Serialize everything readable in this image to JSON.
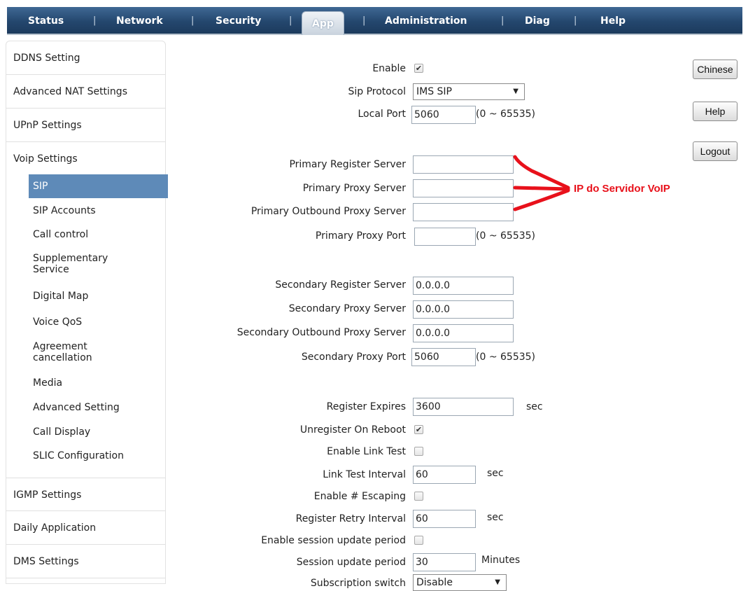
{
  "nav": {
    "tabs": [
      "Status",
      "Network",
      "Security",
      "App",
      "Administration",
      "Diag",
      "Help"
    ],
    "active": "App"
  },
  "sidebar": {
    "sections": {
      "ddns": "DDNS Setting",
      "nat": "Advanced NAT Settings",
      "upnp": "UPnP Settings",
      "voip": "Voip Settings",
      "igmp": "IGMP Settings",
      "daily": "Daily Application",
      "dms": "DMS Settings"
    },
    "voip_items": {
      "sip": "SIP",
      "sip_accounts": "SIP Accounts",
      "call_control": "Call control",
      "supplementary": "Supplementary\nService",
      "digital_map": "Digital Map",
      "voice_qos": "Voice QoS",
      "agreement": "Agreement\ncancellation",
      "media": "Media",
      "advanced": "Advanced Setting",
      "call_display": "Call Display",
      "slic": "SLIC Configuration"
    }
  },
  "form": {
    "enable": {
      "label": "Enable",
      "checked": true
    },
    "sip_protocol": {
      "label": "Sip Protocol",
      "value": "IMS SIP"
    },
    "local_port": {
      "label": "Local Port",
      "value": "5060",
      "hint": "(0 ~ 65535)"
    },
    "primary_register": {
      "label": "Primary Register Server",
      "value": ""
    },
    "primary_proxy": {
      "label": "Primary Proxy Server",
      "value": ""
    },
    "primary_outbound": {
      "label": "Primary Outbound Proxy Server",
      "value": ""
    },
    "primary_port": {
      "label": "Primary Proxy Port",
      "value": "",
      "hint": "(0 ~ 65535)"
    },
    "secondary_register": {
      "label": "Secondary Register Server",
      "value": "0.0.0.0"
    },
    "secondary_proxy": {
      "label": "Secondary Proxy Server",
      "value": "0.0.0.0"
    },
    "secondary_outbound": {
      "label": "Secondary Outbound Proxy Server",
      "value": "0.0.0.0"
    },
    "secondary_port": {
      "label": "Secondary Proxy Port",
      "value": "5060",
      "hint": "(0 ~ 65535)"
    },
    "register_expires": {
      "label": "Register Expires",
      "value": "3600",
      "unit": "sec"
    },
    "unregister_reboot": {
      "label": "Unregister On Reboot",
      "checked": true
    },
    "enable_link_test": {
      "label": "Enable Link Test",
      "checked": false
    },
    "link_test_interval": {
      "label": "Link Test Interval",
      "value": "60",
      "unit": "sec"
    },
    "enable_escaping": {
      "label": "Enable # Escaping",
      "checked": false
    },
    "register_retry": {
      "label": "Register Retry Interval",
      "value": "60",
      "unit": "sec"
    },
    "session_update_enable": {
      "label": "Enable session update period",
      "checked": false
    },
    "session_update_period": {
      "label": "Session update period",
      "value": "30",
      "unit": "Minutes"
    },
    "subscription_switch": {
      "label": "Subscription switch",
      "value": "Disable"
    }
  },
  "right_buttons": {
    "chinese": "Chinese",
    "help": "Help",
    "logout": "Logout"
  },
  "annotation": {
    "text": "IP do Servidor VoIP",
    "color": "#e8111b"
  },
  "colors": {
    "nav_bg": "#24476e",
    "sidebar_active": "#5e8ab8"
  }
}
